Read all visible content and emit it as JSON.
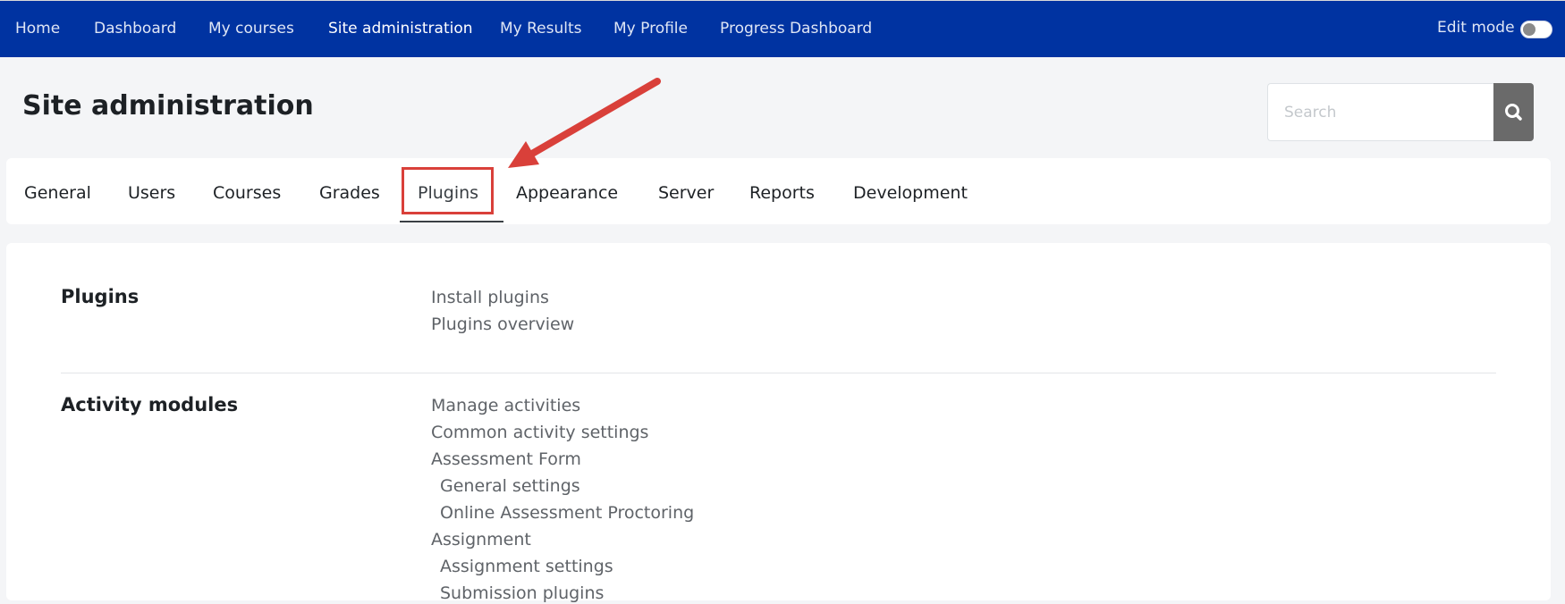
{
  "navbar": {
    "items": [
      {
        "label": "Home"
      },
      {
        "label": "Dashboard"
      },
      {
        "label": "My courses"
      },
      {
        "label": "Site administration"
      },
      {
        "label": "My Results"
      },
      {
        "label": "My Profile"
      },
      {
        "label": "Progress Dashboard"
      }
    ],
    "active_item": "Site administration",
    "edit_mode_label": "Edit mode",
    "edit_mode_on": false
  },
  "page": {
    "title": "Site administration"
  },
  "search": {
    "placeholder": "Search",
    "value": "",
    "button_icon": "search-icon"
  },
  "tabs": {
    "items": [
      {
        "label": "General"
      },
      {
        "label": "Users"
      },
      {
        "label": "Courses"
      },
      {
        "label": "Grades"
      },
      {
        "label": "Plugins"
      },
      {
        "label": "Appearance"
      },
      {
        "label": "Server"
      },
      {
        "label": "Reports"
      },
      {
        "label": "Development"
      }
    ],
    "active_tab": "Plugins"
  },
  "sections": [
    {
      "title": "Plugins",
      "links": [
        {
          "label": "Install plugins",
          "indented": false
        },
        {
          "label": "Plugins overview",
          "indented": false
        }
      ]
    },
    {
      "title": "Activity modules",
      "links": [
        {
          "label": "Manage activities",
          "indented": false
        },
        {
          "label": "Common activity settings",
          "indented": false
        },
        {
          "label": "Assessment Form",
          "indented": false
        },
        {
          "label": "General settings",
          "indented": true
        },
        {
          "label": "Online Assessment Proctoring",
          "indented": true
        },
        {
          "label": "Assignment",
          "indented": false
        },
        {
          "label": "Assignment settings",
          "indented": true
        },
        {
          "label": "Submission plugins",
          "indented": true
        }
      ]
    }
  ],
  "colors": {
    "navbar_bg": "#0033a1",
    "annotation": "#d9403a",
    "search_button": "#6a6a6a"
  }
}
